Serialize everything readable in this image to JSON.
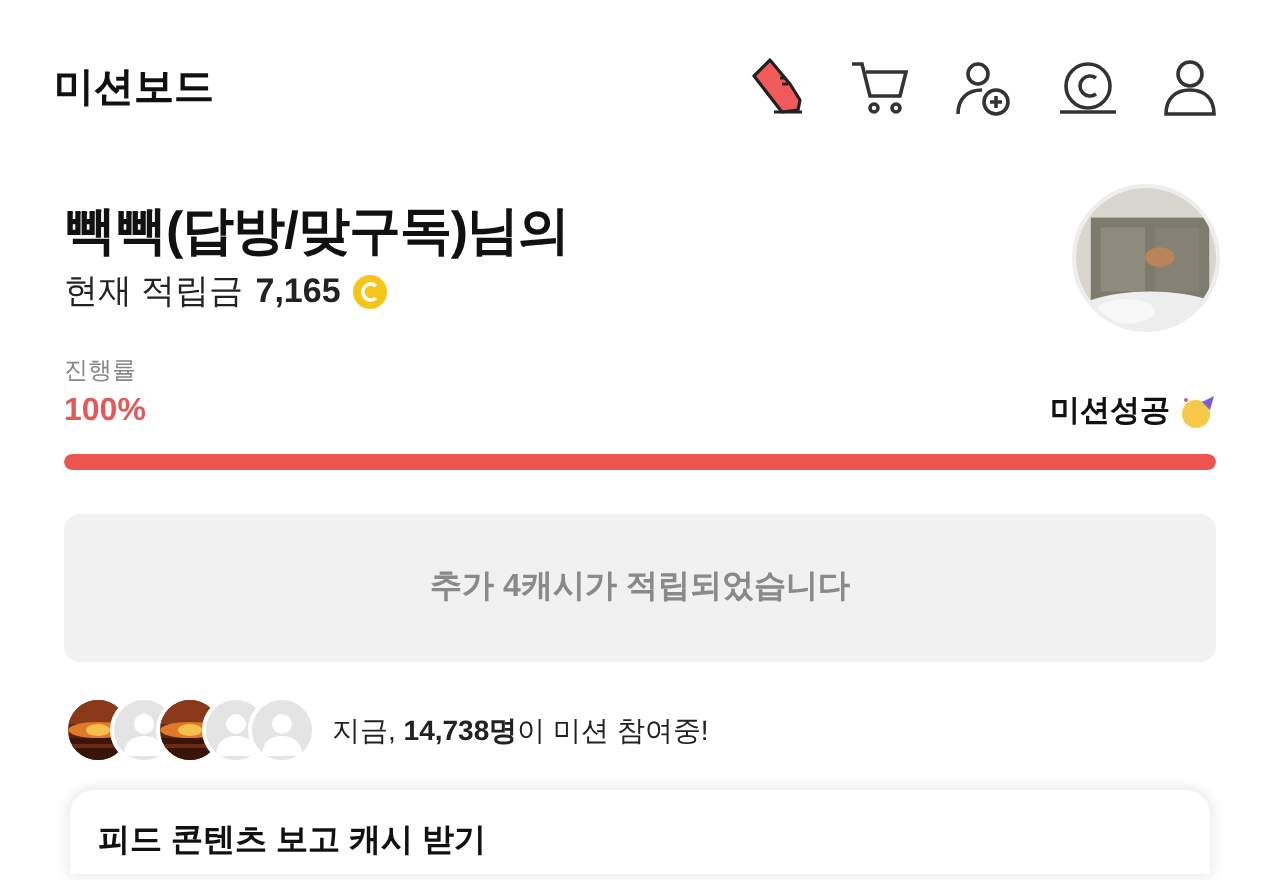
{
  "header": {
    "title": "미션보드"
  },
  "profile": {
    "nickname": "빽빽(답방/맞구독)님의",
    "points_label": "현재 적립금",
    "points": "7,165",
    "avatar": {
      "kind": "picture"
    }
  },
  "progress": {
    "label": "진행률",
    "percent": "100%",
    "level": 1,
    "status": "미션성공"
  },
  "notice": "추가 4캐시가 적립되었습니다",
  "participants": {
    "avatars": [
      {
        "kind": "picture"
      },
      {
        "kind": "default"
      },
      {
        "kind": "picture"
      },
      {
        "kind": "default"
      },
      {
        "kind": "default"
      }
    ],
    "text": "지금, **14,738명**이 미션 참여중!"
  },
  "card": {
    "title": "피드 콘텐츠 보고 캐시 받기"
  }
}
